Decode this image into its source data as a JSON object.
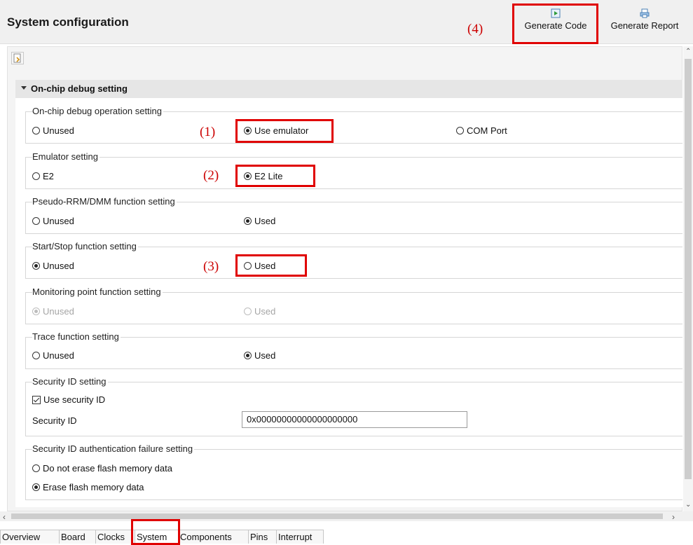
{
  "header": {
    "title": "System configuration",
    "generate_code_label": "Generate Code",
    "generate_report_label": "Generate Report"
  },
  "annotations": [
    "(1)",
    "(2)",
    "(3)",
    "(4)"
  ],
  "section": {
    "title": "On-chip debug setting"
  },
  "groups": {
    "debug_operation": {
      "title": "On-chip debug operation setting",
      "options": [
        "Unused",
        "Use emulator",
        "COM Port"
      ],
      "selected": "Use emulator"
    },
    "emulator": {
      "title": "Emulator setting",
      "options": [
        "E2",
        "E2 Lite"
      ],
      "selected": "E2 Lite"
    },
    "pseudo_rrm": {
      "title": "Pseudo-RRM/DMM function setting",
      "options": [
        "Unused",
        "Used"
      ],
      "selected": "Used"
    },
    "start_stop": {
      "title": "Start/Stop function setting",
      "options": [
        "Unused",
        "Used"
      ],
      "selected": "Unused"
    },
    "monitoring": {
      "title": "Monitoring point function setting",
      "options": [
        "Unused",
        "Used"
      ],
      "selected": "Unused",
      "disabled": true
    },
    "trace": {
      "title": "Trace function setting",
      "options": [
        "Unused",
        "Used"
      ],
      "selected": "Used"
    },
    "security_id": {
      "title": "Security ID setting",
      "checkbox_label": "Use security ID",
      "checked": true,
      "field_label": "Security ID",
      "field_value": "0x00000000000000000000"
    },
    "auth_failure": {
      "title": "Security ID authentication failure setting",
      "options": [
        "Do not erase flash memory data",
        "Erase flash memory data"
      ],
      "selected": "Erase flash memory data"
    }
  },
  "tabs": [
    "Overview",
    "Board",
    "Clocks",
    "System",
    "Components",
    "Pins",
    "Interrupt"
  ],
  "active_tab": "System",
  "colors": {
    "highlight": "#e00000",
    "annotation": "#cc0000"
  }
}
